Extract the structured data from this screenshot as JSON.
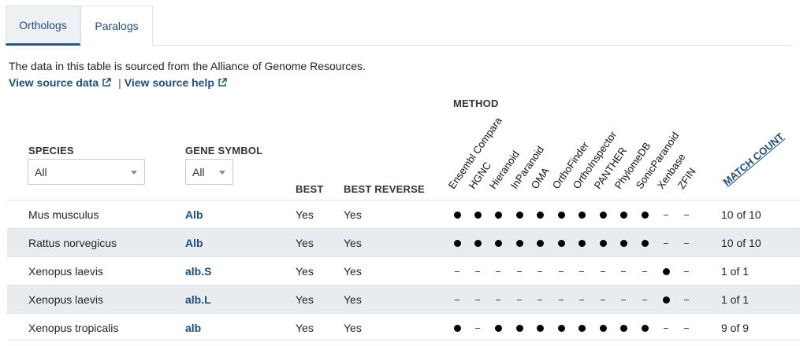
{
  "tabs": [
    {
      "label": "Orthologs",
      "active": true
    },
    {
      "label": "Paralogs",
      "active": false
    }
  ],
  "intro_text": "The data in this table is sourced from the Alliance of Genome Resources.",
  "links": {
    "source_data": "View source data",
    "separator": "|",
    "source_help": "View source help"
  },
  "table": {
    "headers": {
      "method": "METHOD",
      "species": "SPECIES",
      "gene_symbol": "GENE SYMBOL",
      "best": "BEST",
      "best_reverse": "BEST REVERSE",
      "match_count": "MATCH COUNT"
    },
    "filters": {
      "species": "All",
      "gene_symbol": "All"
    },
    "methods": [
      "Ensembl Compara",
      "HGNC",
      "Hieranoid",
      "InParanoid",
      "OMA",
      "OrthoFinder",
      "OrthoInspector",
      "PANTHER",
      "PhylomeDB",
      "SonicParanoid",
      "Xenbase",
      "ZFIN"
    ],
    "rows": [
      {
        "species": "Mus musculus",
        "gene": "Alb",
        "best": "Yes",
        "best_reverse": "Yes",
        "marks": [
          1,
          1,
          1,
          1,
          1,
          1,
          1,
          1,
          1,
          1,
          0,
          0
        ],
        "match": "10 of 10"
      },
      {
        "species": "Rattus norvegicus",
        "gene": "Alb",
        "best": "Yes",
        "best_reverse": "Yes",
        "marks": [
          1,
          1,
          1,
          1,
          1,
          1,
          1,
          1,
          1,
          1,
          0,
          0
        ],
        "match": "10 of 10"
      },
      {
        "species": "Xenopus laevis",
        "gene": "alb.S",
        "best": "Yes",
        "best_reverse": "Yes",
        "marks": [
          0,
          0,
          0,
          0,
          0,
          0,
          0,
          0,
          0,
          0,
          1,
          0
        ],
        "match": "1 of 1"
      },
      {
        "species": "Xenopus laevis",
        "gene": "alb.L",
        "best": "Yes",
        "best_reverse": "Yes",
        "marks": [
          0,
          0,
          0,
          0,
          0,
          0,
          0,
          0,
          0,
          0,
          1,
          0
        ],
        "match": "1 of 1"
      },
      {
        "species": "Xenopus tropicalis",
        "gene": "alb",
        "best": "Yes",
        "best_reverse": "Yes",
        "marks": [
          1,
          0,
          1,
          1,
          1,
          1,
          1,
          1,
          1,
          1,
          0,
          0
        ],
        "match": "9 of 9"
      }
    ]
  }
}
